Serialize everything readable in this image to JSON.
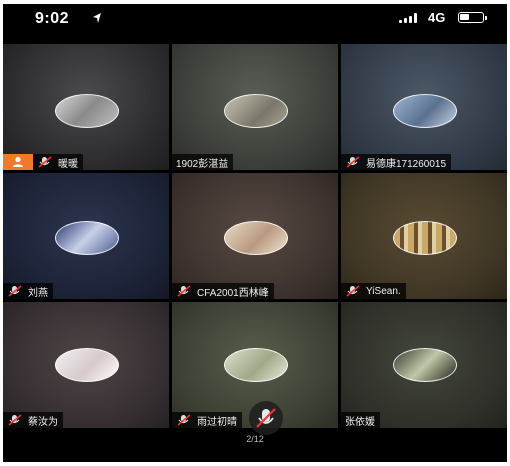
{
  "status_bar": {
    "time": "9:02",
    "network": "4G",
    "location_icon": "location-arrow-icon",
    "signal_icon": "signal-bars-icon",
    "battery_icon": "battery-icon"
  },
  "colors": {
    "host_badge": "#f07a2a",
    "background": "#000000"
  },
  "participants": [
    {
      "name": "暖暖",
      "host": true,
      "muted": true
    },
    {
      "name": "1902彭湛益",
      "host": false,
      "muted": false
    },
    {
      "name": "易德康171260015",
      "host": false,
      "muted": true
    },
    {
      "name": "刘燕",
      "host": false,
      "muted": true
    },
    {
      "name": "CFA2001西林峰",
      "host": false,
      "muted": true
    },
    {
      "name": "YiSean.",
      "host": false,
      "muted": true
    },
    {
      "name": "蔡汝为",
      "host": false,
      "muted": true
    },
    {
      "name": "雨过初晴",
      "host": false,
      "muted": true
    },
    {
      "name": "张依媛",
      "host": false,
      "muted": false
    }
  ],
  "pager": {
    "page_text": "2/12"
  }
}
